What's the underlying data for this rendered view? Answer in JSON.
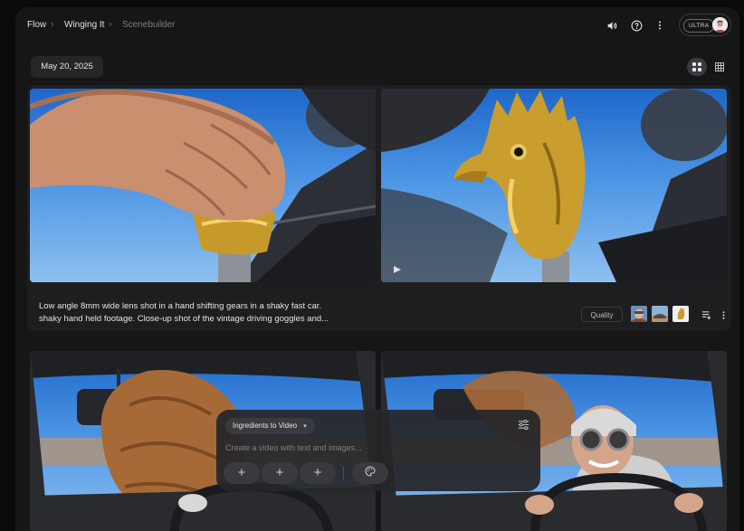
{
  "breadcrumb": [
    {
      "label": "Flow"
    },
    {
      "label": "Winging It"
    },
    {
      "label": "Scenebuilder"
    }
  ],
  "header": {
    "plan_badge": "ULTRA",
    "icons": [
      "volume-icon",
      "help-icon",
      "more-vert-icon"
    ]
  },
  "date": "May 20, 2025",
  "view_toggle": {
    "selected": "grid"
  },
  "scene_card": {
    "prompt_line1": "Low angle 8mm wide lens shot in a hand shifting gears in a shaky fast car.",
    "prompt_line2": "shaky hand held footage. Close-up shot of the vintage driving goggles and...",
    "quality_label": "Quality",
    "ingredients_count": 3
  },
  "composer": {
    "mode_label": "Ingredients to Video",
    "placeholder": "Create a video with text and images...",
    "add_buttons": [
      "+",
      "+",
      "+"
    ]
  },
  "colors": {
    "background": "#161617",
    "card": "#1e1e20",
    "accent_gold": "#d4aa3c",
    "sky": "#4a93e3"
  }
}
